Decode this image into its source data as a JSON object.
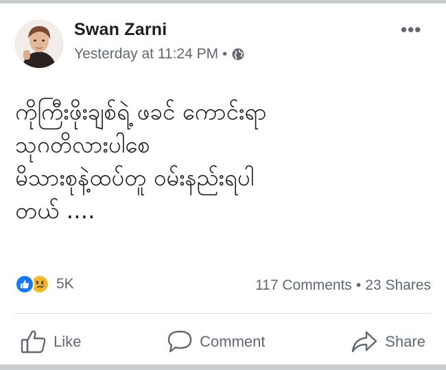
{
  "post": {
    "author": "Swan Zarni",
    "timestamp": "Yesterday at 11:24 PM",
    "meta_separator": "•",
    "privacy_icon": "globe-icon",
    "more_icon": "•••",
    "text_lines": [
      "ကိုကြီးဖိုးချစ်ရဲ့ ဖခင် ကောင်းရာ",
      "သုဂတိလားပါစေ",
      "မိသားစုနဲ့ထပ်တူ ဝမ်းနည်းရပါ",
      "တယ် ...."
    ]
  },
  "reactions": {
    "icons": [
      "like-icon",
      "sad-icon"
    ],
    "count": "5K"
  },
  "engagement": {
    "comments": "117 Comments",
    "separator": "•",
    "shares": "23 Shares"
  },
  "actions": {
    "like": "Like",
    "comment": "Comment",
    "share": "Share"
  },
  "colors": {
    "like_blue": "#1877f2",
    "sad_yellow": "#f7b928",
    "secondary_text": "#606770",
    "primary_text": "#1c1e21"
  }
}
